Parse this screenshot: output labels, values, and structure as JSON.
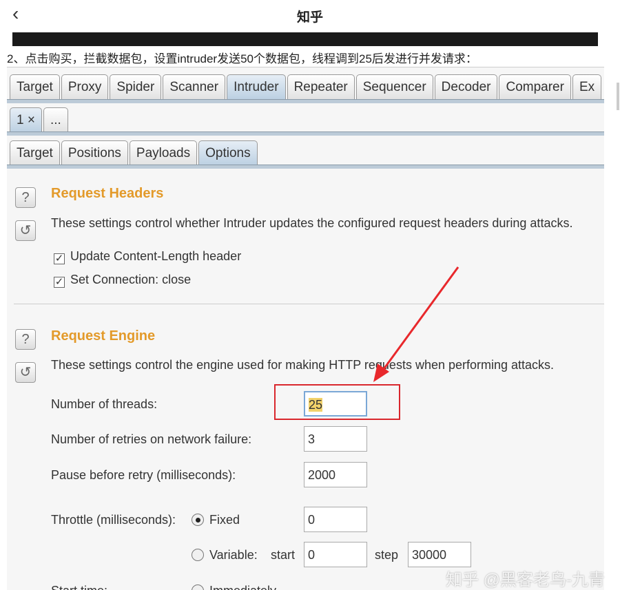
{
  "header": {
    "back_icon": "chevron-left-icon",
    "title": "知乎"
  },
  "caption": "2、点击购买，拦截数据包，设置intruder发送50个数据包，线程调到25后发进行并发请求：",
  "burp": {
    "main_tabs": [
      "Target",
      "Proxy",
      "Spider",
      "Scanner",
      "Intruder",
      "Repeater",
      "Sequencer",
      "Decoder",
      "Comparer",
      "Ex"
    ],
    "main_selected": "Intruder",
    "attack_tabs": [
      "1 ×",
      "..."
    ],
    "sub_tabs": [
      "Target",
      "Positions",
      "Payloads",
      "Options"
    ],
    "sub_selected": "Options",
    "request_headers": {
      "title": "Request Headers",
      "desc": "These settings control whether Intruder updates the configured request headers during attacks.",
      "options": [
        {
          "label": "Update Content-Length header",
          "checked": true
        },
        {
          "label": "Set Connection: close",
          "checked": true
        }
      ]
    },
    "request_engine": {
      "title": "Request Engine",
      "desc": "These settings control the engine used for making HTTP requests when performing attacks.",
      "threads_label": "Number of threads:",
      "threads": "25",
      "retries_label": "Number of retries on network failure:",
      "retries": "3",
      "pause_label": "Pause before retry (milliseconds):",
      "pause": "2000",
      "throttle_label": "Throttle (milliseconds):",
      "fixed_label": "Fixed",
      "fixed_value": "0",
      "variable_label": "Variable:",
      "start_label": "start",
      "start_value": "0",
      "step_label": "step",
      "step_value": "30000",
      "start_time_label": "Start time:",
      "immediately_label": "Immediately"
    },
    "highlight_color": "#d9262c"
  },
  "watermark": "知乎 @黑客老鸟-九青"
}
